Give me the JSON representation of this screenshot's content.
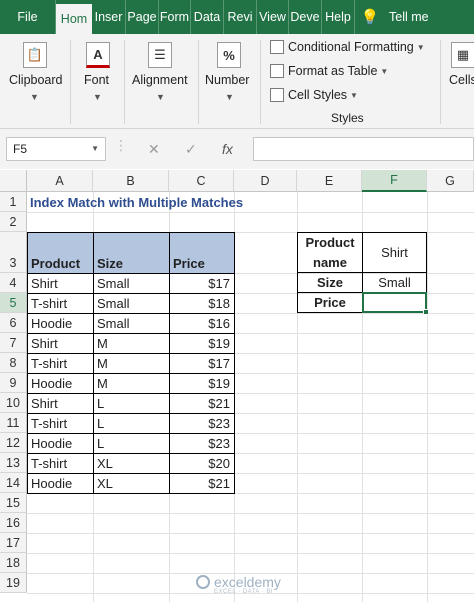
{
  "ribbon_tabs": [
    "File",
    "Hom",
    "Inser",
    "Page",
    "Form",
    "Data",
    "Revi",
    "View",
    "Deve",
    "Help",
    "Tell me"
  ],
  "active_tab_index": 1,
  "ribbon_groups": {
    "clipboard": "Clipboard",
    "font": "Font",
    "alignment": "Alignment",
    "number": "Number",
    "number_icon": "%",
    "font_icon": "A",
    "cells": "Cells",
    "styles_title": "Styles",
    "styles_items": [
      "Conditional Formatting",
      "Format as Table",
      "Cell Styles"
    ]
  },
  "formula_bar": {
    "name_box": "F5",
    "fx": "fx",
    "cancel": "✕",
    "enter": "✓",
    "formula": ""
  },
  "columns": [
    "A",
    "B",
    "C",
    "D",
    "E",
    "F",
    "G"
  ],
  "selected_column": "F",
  "rows": [
    "1",
    "2",
    "3",
    "4",
    "5",
    "6",
    "7",
    "8",
    "9",
    "10",
    "11",
    "12",
    "13",
    "14",
    "15",
    "16",
    "17",
    "18",
    "19"
  ],
  "selected_row": "5",
  "sheet": {
    "title": "Index Match with Multiple Matches",
    "table_headers": [
      "Product",
      "Size",
      "Price"
    ],
    "table_rows": [
      [
        "Shirt",
        "Small",
        "$17"
      ],
      [
        "T-shirt",
        "Small",
        "$18"
      ],
      [
        "Hoodie",
        "Small",
        "$16"
      ],
      [
        "Shirt",
        "M",
        "$19"
      ],
      [
        "T-shirt",
        "M",
        "$17"
      ],
      [
        "Hoodie",
        "M",
        "$19"
      ],
      [
        "Shirt",
        "L",
        "$21"
      ],
      [
        "T-shirt",
        "L",
        "$23"
      ],
      [
        "Hoodie",
        "L",
        "$23"
      ],
      [
        "T-shirt",
        "XL",
        "$20"
      ],
      [
        "Hoodie",
        "XL",
        "$21"
      ]
    ],
    "lookup": {
      "product_label": "Product name",
      "product_value": "Shirt",
      "size_label": "Size",
      "size_value": "Small",
      "price_label": "Price",
      "price_value": ""
    }
  },
  "watermark": {
    "name": "exceldemy",
    "tagline": "EXCEL · DATA · BI"
  },
  "colors": {
    "excel_green": "#217346",
    "table_header": "#b4c5e0",
    "title_blue": "#2f4e8f"
  }
}
